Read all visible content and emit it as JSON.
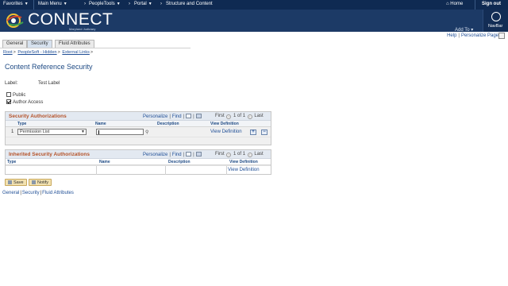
{
  "topnav": {
    "favorites": "Favorites",
    "main_menu": "Main Menu",
    "peopletools": "PeopleTools",
    "portal": "Portal",
    "structure": "Structure and Content",
    "home": "Home",
    "signout": "Sign out"
  },
  "banner": {
    "logo_word": "CONNECT",
    "logo_sub": "Maryland Judiciary",
    "add_to": "Add To",
    "navbar": "NavBar"
  },
  "helpbar": {
    "help": "Help",
    "personalize_page": "Personalize Page"
  },
  "tabs": [
    "General",
    "Security",
    "Fluid Attributes"
  ],
  "breadcrumb": [
    "Root",
    "PeopleSoft - Hidden",
    "External Links"
  ],
  "page_title": "Content Reference Security",
  "label_field": {
    "label": "Label:",
    "value": "Test Label"
  },
  "checkboxes": {
    "public": {
      "label": "Public",
      "checked": false
    },
    "author_access": {
      "label": "Author Access",
      "checked": true
    }
  },
  "security_grid": {
    "title": "Security Authorizations",
    "personalize": "Personalize",
    "find": "Find",
    "first": "First",
    "range": "1 of 1",
    "last": "Last",
    "columns": [
      "Type",
      "Name",
      "Description",
      "View Definition"
    ],
    "row": {
      "num": "1",
      "type_value": "Permission List",
      "name_value": "",
      "view_link": "View Definition",
      "add": "+",
      "remove": "−"
    }
  },
  "inherited_grid": {
    "title": "Inherited Security Authorizations",
    "personalize": "Personalize",
    "find": "Find",
    "first": "First",
    "range": "1 of 1",
    "last": "Last",
    "columns": [
      "Type",
      "Name",
      "Description",
      "View Definition"
    ],
    "view_link": "View Definition"
  },
  "buttons": {
    "save": "Save",
    "notify": "Notify"
  },
  "footlinks": [
    "General",
    "Security",
    "Fluid Attributes"
  ],
  "colors": {
    "nav": "#0f2a52",
    "banner": "#1c3a66",
    "title": "#1e4a84",
    "grid_title": "#b5532a",
    "link": "#1f4e96"
  }
}
